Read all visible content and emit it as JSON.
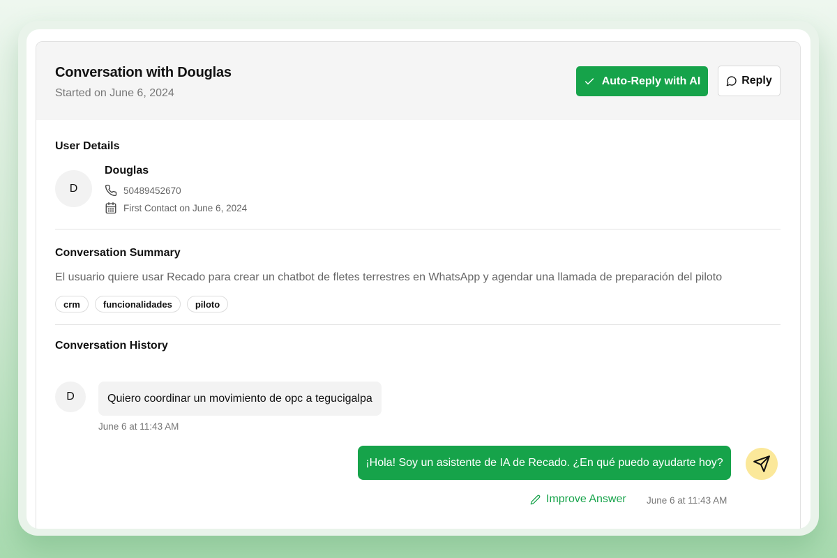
{
  "header": {
    "title": "Conversation with Douglas",
    "subtitle": "Started on June 6, 2024",
    "auto_reply_label": "Auto-Reply with AI",
    "reply_label": "Reply"
  },
  "user_details": {
    "section_title": "User Details",
    "avatar_initial": "D",
    "name": "Douglas",
    "phone": "50489452670",
    "first_contact": "First Contact on June 6, 2024"
  },
  "summary": {
    "section_title": "Conversation Summary",
    "text": "El usuario quiere usar Recado para crear un chatbot de fletes terrestres en WhatsApp y agendar una llamada de preparación del piloto",
    "tags": [
      "crm",
      "funcionalidades",
      "piloto"
    ]
  },
  "history": {
    "section_title": "Conversation History",
    "messages": [
      {
        "sender_initial": "D",
        "text": "Quiero coordinar un movimiento de opc a tegucigalpa",
        "time": "June 6 at 11:43 AM"
      },
      {
        "text": "¡Hola! Soy un asistente de IA de Recado. ¿En qué puedo ayudarte hoy?",
        "time": "June 6 at 11:43 AM",
        "improve_label": "Improve Answer"
      }
    ]
  },
  "colors": {
    "accent": "#16a34a",
    "bot_avatar": "#fbe89a",
    "header_bg": "#f5f5f5"
  },
  "icons": {
    "auto_reply": "check-icon",
    "reply": "message-circle-icon",
    "phone": "phone-icon",
    "calendar": "calendar-icon",
    "bot_avatar": "send-icon",
    "improve": "pencil-icon"
  }
}
